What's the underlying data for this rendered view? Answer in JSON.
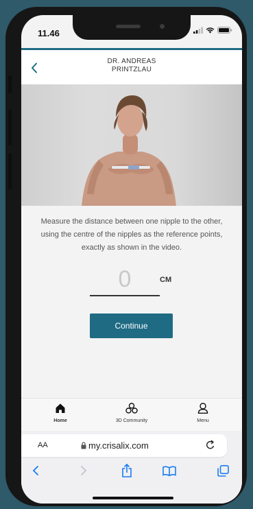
{
  "status_bar": {
    "time": "11.46"
  },
  "header": {
    "title_line1": "DR. ANDREAS",
    "title_line2": "PRINTZLAU"
  },
  "instruction": "Measure the distance between one nipple to the other, using the centre of the nipples as the reference points, exactly as shown in the video.",
  "measurement": {
    "value": "0",
    "unit": "CM"
  },
  "continue_label": "Continue",
  "tabs": [
    {
      "label": "Home",
      "icon": "home-icon"
    },
    {
      "label": "3D Community",
      "icon": "community-icon"
    },
    {
      "label": "Menu",
      "icon": "user-icon"
    }
  ],
  "browser": {
    "text_size": "AA",
    "url": "my.crisalix.com"
  },
  "colors": {
    "accent": "#1f6b84",
    "background": "#2e5a6a"
  }
}
